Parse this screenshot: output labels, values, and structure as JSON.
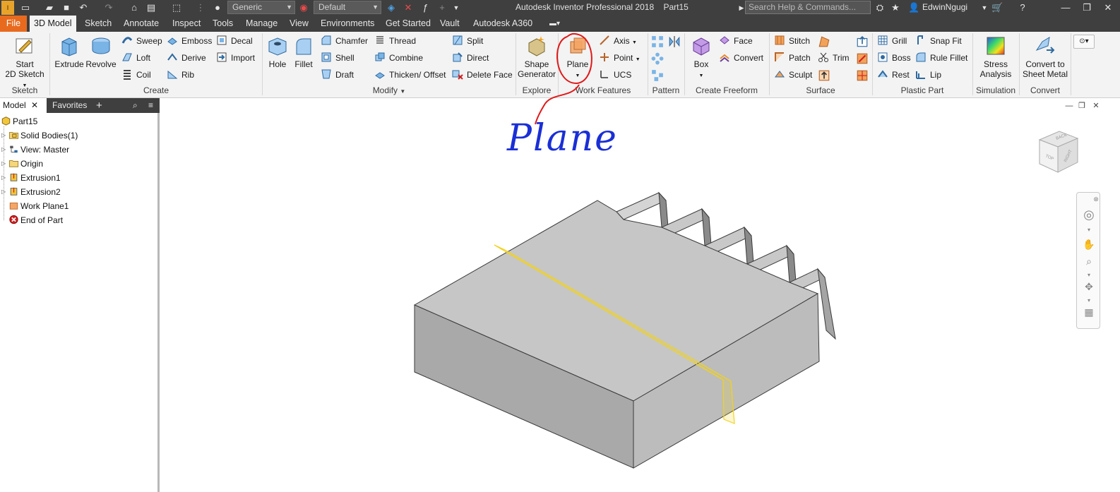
{
  "window": {
    "app_title": "Autodesk Inventor Professional 2018",
    "doc_name": "Part15",
    "search_placeholder": "Search Help & Commands...",
    "user": "EdwinNgugi",
    "material_combo": "Generic",
    "appearance_combo": "Default"
  },
  "tabs": [
    "File",
    "3D Model",
    "Sketch",
    "Annotate",
    "Inspect",
    "Tools",
    "Manage",
    "View",
    "Environments",
    "Get Started",
    "Vault",
    "Autodesk A360"
  ],
  "ribbon": {
    "sketch": {
      "start_line1": "Start",
      "start_line2": "2D Sketch",
      "title": "Sketch"
    },
    "create": {
      "extrude": "Extrude",
      "revolve": "Revolve",
      "sweep": "Sweep",
      "loft": "Loft",
      "coil": "Coil",
      "emboss": "Emboss",
      "derive": "Derive",
      "rib": "Rib",
      "decal": "Decal",
      "import": "Import",
      "title": "Create"
    },
    "modify": {
      "hole": "Hole",
      "fillet": "Fillet",
      "chamfer": "Chamfer",
      "shell": "Shell",
      "draft": "Draft",
      "thread": "Thread",
      "combine": "Combine",
      "thicken": "Thicken/ Offset",
      "split": "Split",
      "direct": "Direct",
      "delete_face": "Delete Face",
      "title": "Modify"
    },
    "explore": {
      "shape1": "Shape",
      "shape2": "Generator",
      "title": "Explore"
    },
    "work": {
      "plane": "Plane",
      "axis": "Axis",
      "point": "Point",
      "ucs": "UCS",
      "title": "Work Features"
    },
    "pattern": {
      "title": "Pattern"
    },
    "freeform": {
      "box": "Box",
      "face": "Face",
      "convert": "Convert",
      "title": "Create Freeform"
    },
    "surface": {
      "stitch": "Stitch",
      "patch": "Patch",
      "sculpt": "Sculpt",
      "trim": "Trim",
      "title": "Surface"
    },
    "plastic": {
      "grill": "Grill",
      "boss": "Boss",
      "rest": "Rest",
      "snap_fit": "Snap Fit",
      "rule_fillet": "Rule Fillet",
      "lip": "Lip",
      "title": "Plastic Part"
    },
    "simulation": {
      "l1": "Stress",
      "l2": "Analysis",
      "title": "Simulation"
    },
    "convert": {
      "l1": "Convert to",
      "l2": "Sheet Metal",
      "title": "Convert"
    }
  },
  "browser": {
    "tab_model": "Model",
    "tab_favorites": "Favorites",
    "tree": [
      "Part15",
      "Solid Bodies(1)",
      "View: Master",
      "Origin",
      "Extrusion1",
      "Extrusion2",
      "Work Plane1",
      "End of Part"
    ]
  },
  "viewcube": {
    "top": "TOP",
    "right": "RIGHT",
    "back": "BACK"
  },
  "annotation": {
    "text": "Plane"
  },
  "colors": {
    "accent_file_tab": "#e86a1e",
    "annotation_red": "#e01919",
    "annotation_blue": "#1a2fd6",
    "work_plane": "#f2d31c"
  }
}
